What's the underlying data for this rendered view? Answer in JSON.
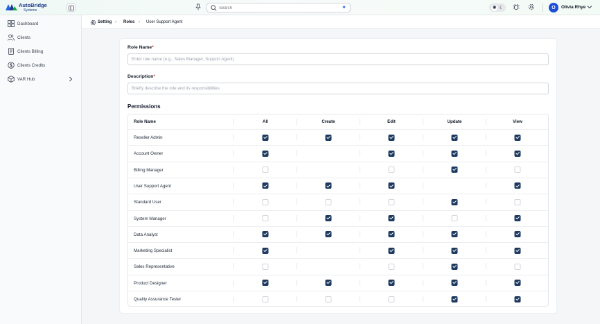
{
  "header": {
    "brand_name": "AutoBridge",
    "brand_sub": "Systems",
    "search_placeholder": "Search",
    "user_initial": "O",
    "user_name": "Olivia Rhye"
  },
  "sidebar": {
    "items": [
      {
        "label": "Dashboard",
        "icon": "dashboard-icon"
      },
      {
        "label": "Clients",
        "icon": "users-icon"
      },
      {
        "label": "Clients Billing",
        "icon": "billing-icon"
      },
      {
        "label": "Clients Credits",
        "icon": "credits-icon"
      },
      {
        "label": "VAR Hub",
        "icon": "box-icon"
      }
    ]
  },
  "breadcrumb": {
    "setting": "Setting",
    "roles": "Roles",
    "current": "User Support Agent"
  },
  "form": {
    "role_name_label": "Role Name",
    "role_name_placeholder": "Enter role name (e.g., Sales Manager, Support Agent)",
    "description_label": "Description",
    "description_placeholder": "Briefly describe the role and its responsibilities",
    "required_mark": "*",
    "permissions_title": "Permissions"
  },
  "permissions": {
    "columns": [
      "Role Name",
      "All",
      "Create",
      "Edit",
      "Update",
      "View"
    ],
    "rows": [
      {
        "name": "Reseller Admin",
        "perms": [
          true,
          true,
          true,
          true,
          true
        ]
      },
      {
        "name": "Account Owner",
        "perms": [
          true,
          null,
          true,
          true,
          true
        ]
      },
      {
        "name": "Billing Manager",
        "perms": [
          false,
          null,
          false,
          true,
          false
        ]
      },
      {
        "name": "User Support Agent",
        "perms": [
          true,
          true,
          true,
          null,
          true
        ]
      },
      {
        "name": "Standard User",
        "perms": [
          false,
          false,
          false,
          true,
          false
        ]
      },
      {
        "name": "System Manager",
        "perms": [
          false,
          true,
          true,
          false,
          true
        ]
      },
      {
        "name": "Data Analyst",
        "perms": [
          true,
          true,
          true,
          true,
          true
        ]
      },
      {
        "name": "Marketing Specialist",
        "perms": [
          true,
          null,
          true,
          true,
          true
        ]
      },
      {
        "name": "Sales Representative",
        "perms": [
          false,
          null,
          false,
          true,
          false
        ]
      },
      {
        "name": "Product Designer",
        "perms": [
          true,
          true,
          true,
          true,
          true
        ]
      },
      {
        "name": "Quality Assurance Tester",
        "perms": [
          false,
          false,
          false,
          true,
          true
        ]
      }
    ]
  },
  "colors": {
    "accent": "#1e3a5f",
    "brand": "#1e3a8a",
    "required": "#dc2626"
  }
}
